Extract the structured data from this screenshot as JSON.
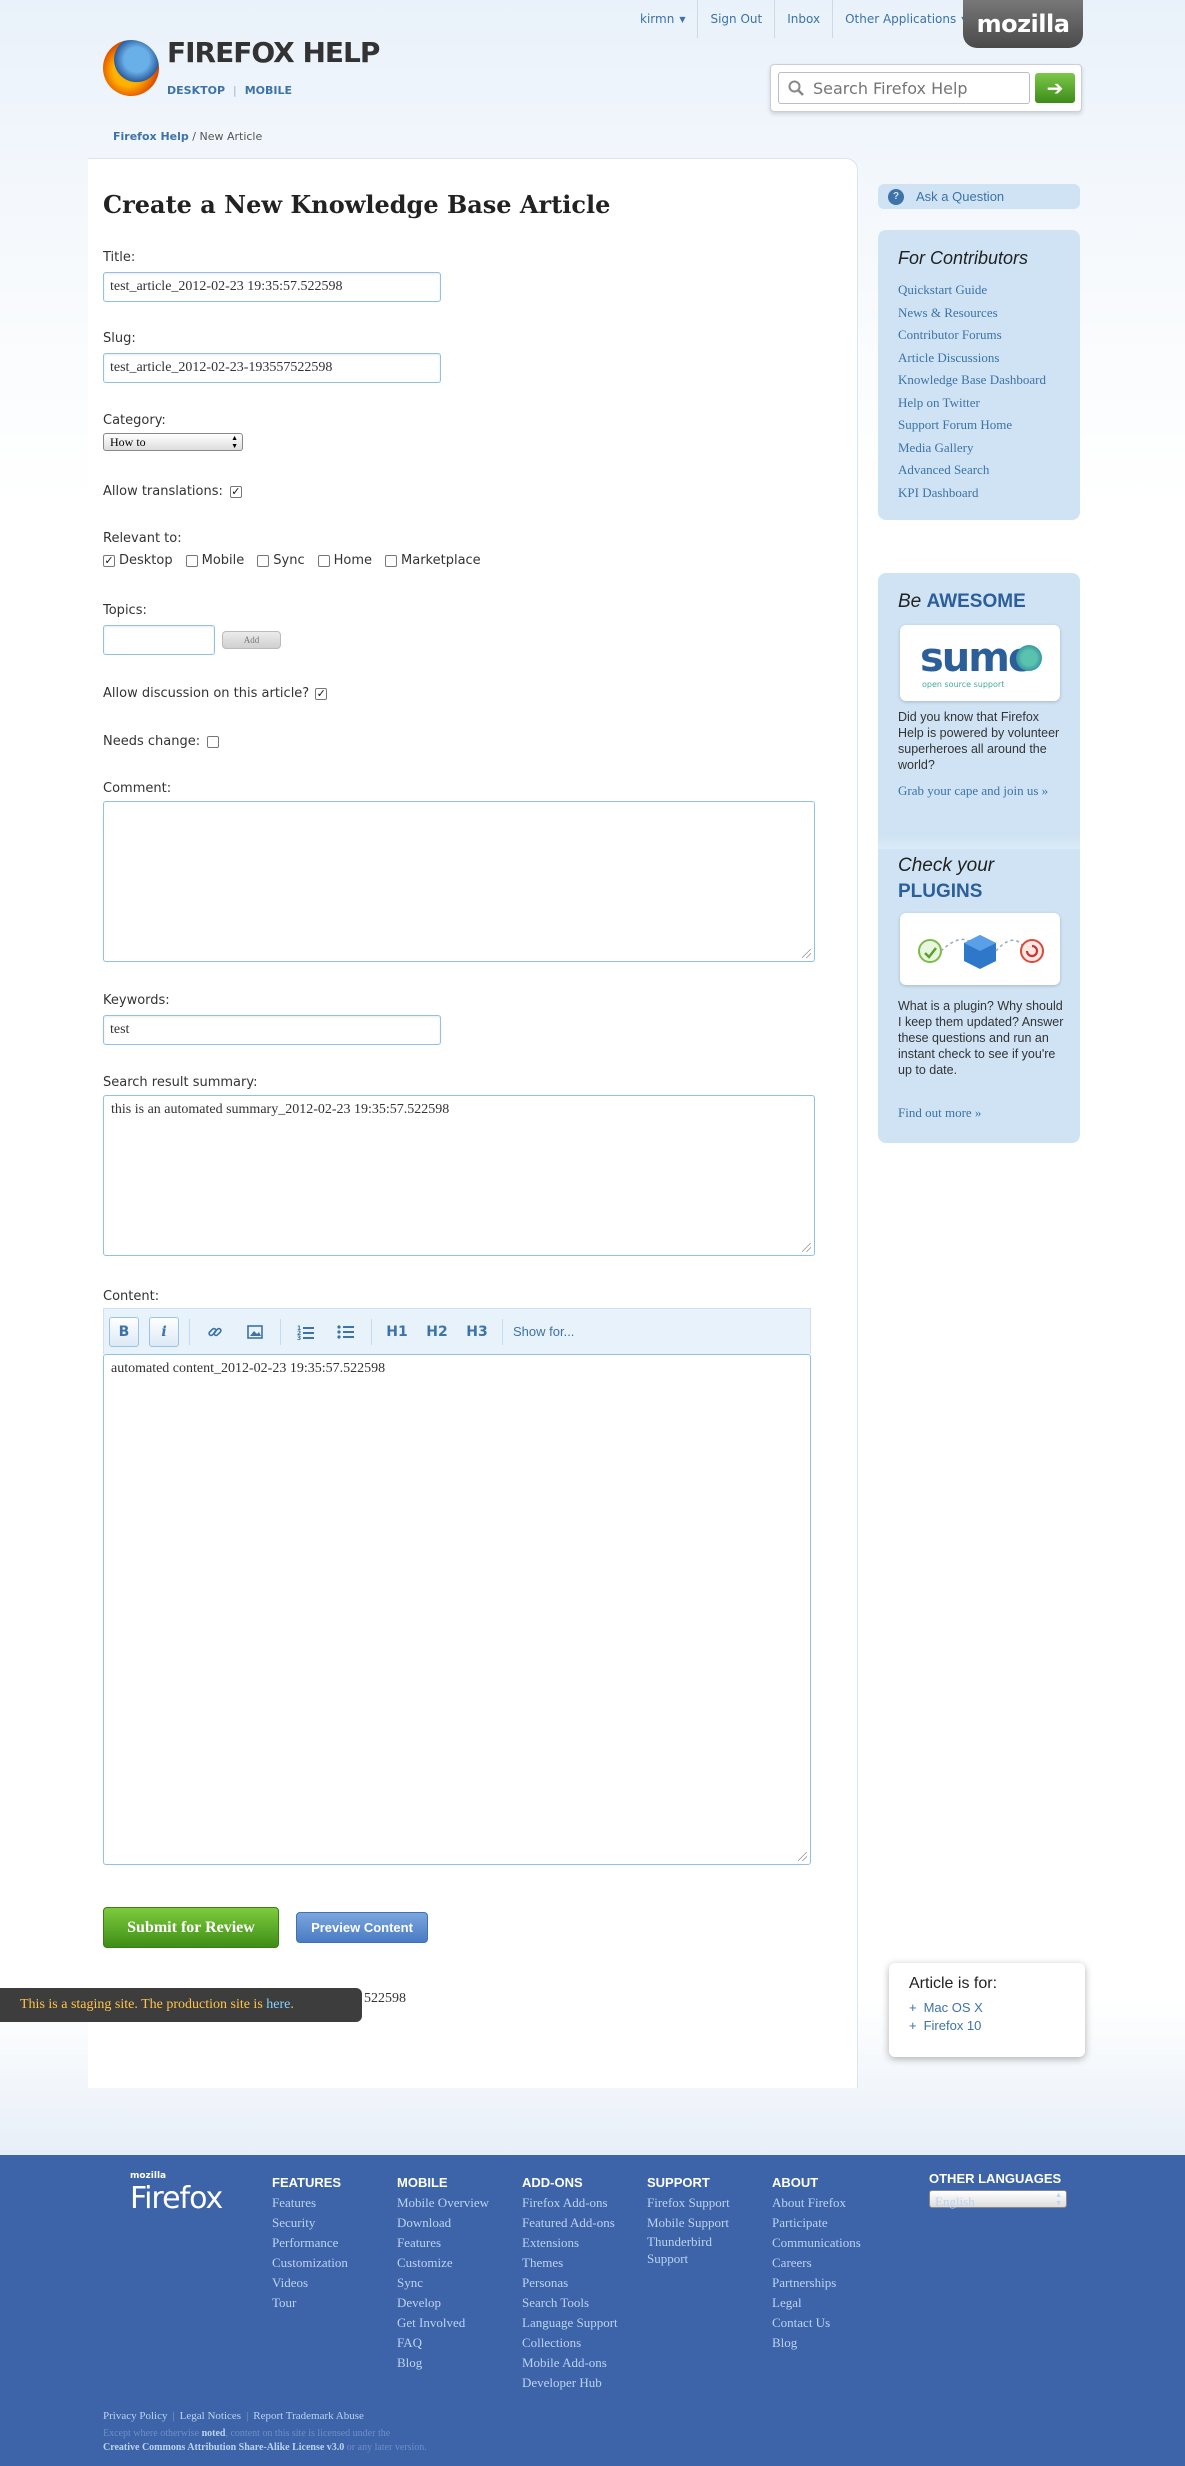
{
  "header": {
    "user_label": "kirmn",
    "sign_out": "Sign Out",
    "inbox": "Inbox",
    "other_apps": "Other Applications",
    "mozilla_tab": "mozilla",
    "brand_title": "FIREFOX HELP",
    "brand_desktop": "DESKTOP",
    "brand_mobile": "MOBILE",
    "search_placeholder": "Search Firefox Help",
    "search_go_icon": "arrow-right-icon"
  },
  "breadcrumb": {
    "home": "Firefox Help",
    "separator": "/",
    "current": "New Article"
  },
  "form": {
    "page_title": "Create a New Knowledge Base Article",
    "title_label": "Title:",
    "title_value": "test_article_2012-02-23 19:35:57.522598",
    "slug_label": "Slug:",
    "slug_value": "test_article_2012-02-23-193557522598",
    "category_label": "Category:",
    "category_value": "How to",
    "allow_translations_label": "Allow translations:",
    "allow_translations_checked": true,
    "relevant_label": "Relevant to:",
    "relevant_options": [
      {
        "label": "Desktop",
        "checked": true
      },
      {
        "label": "Mobile",
        "checked": false
      },
      {
        "label": "Sync",
        "checked": false
      },
      {
        "label": "Home",
        "checked": false
      },
      {
        "label": "Marketplace",
        "checked": false
      }
    ],
    "topics_label": "Topics:",
    "topics_value": "",
    "add_button": "Add",
    "allow_discussion_label": "Allow discussion on this article?",
    "allow_discussion_checked": true,
    "needs_change_label": "Needs change:",
    "needs_change_checked": false,
    "comment_label": "Comment:",
    "comment_value": "",
    "keywords_label": "Keywords:",
    "keywords_value": "test",
    "summary_label": "Search result summary:",
    "summary_value": "this is an automated summary_2012-02-23 19:35:57.522598",
    "content_label": "Content:",
    "content_value": "automated content_2012-02-23 19:35:57.522598",
    "toolbar": {
      "bold": "B",
      "italic": "i",
      "h1": "H1",
      "h2": "H2",
      "h3": "H3",
      "show_for": "Show for..."
    },
    "submit_button": "Submit for Review",
    "preview_button": "Preview Content"
  },
  "staging": {
    "message": "This is a staging site. The production site is ",
    "link": "here",
    "end": "."
  },
  "overlapped_text": "522598",
  "article_for": {
    "title": "Article is for:",
    "items": [
      "Mac OS X",
      "Firefox 10"
    ]
  },
  "sidebar": {
    "ask_question": "Ask a Question",
    "contributors_title": "For Contributors",
    "contributors_links": [
      "Quickstart Guide",
      "News & Resources",
      "Contributor Forums",
      "Article Discussions",
      "Knowledge Base Dashboard",
      "Help on Twitter",
      "Support Forum Home",
      "Media Gallery",
      "Advanced Search",
      "KPI Dashboard"
    ],
    "awesome_be": "Be",
    "awesome_word": "AWESOME",
    "sumo_logo": "sumo",
    "sumo_tagline": "open source support",
    "awesome_text": "Did you know that Firefox Help is powered by volunteer superheroes all around the world?",
    "awesome_link": "Grab your cape and join us »",
    "plugins_check": "Check your",
    "plugins_word": "PLUGINS",
    "plugins_text": "What is a plugin? Why should I keep them updated? Answer these questions and run an instant check to see if you're up to date.",
    "plugins_link": "Find out more »"
  },
  "footer": {
    "brand_small": "mozilla",
    "brand_big": "Firefox",
    "columns": [
      {
        "title": "FEATURES",
        "items": [
          "Features",
          "Security",
          "Performance",
          "Customization",
          "Videos",
          "Tour"
        ]
      },
      {
        "title": "MOBILE",
        "items": [
          "Mobile Overview",
          "Download",
          "Features",
          "Customize",
          "Sync",
          "Develop",
          "Get Involved",
          "FAQ",
          "Blog"
        ]
      },
      {
        "title": "ADD-ONS",
        "items": [
          "Firefox Add-ons",
          "Featured Add-ons",
          "Extensions",
          "Themes",
          "Personas",
          "Search Tools",
          "Language Support",
          "Collections",
          "Mobile Add-ons",
          "Developer Hub"
        ]
      },
      {
        "title": "SUPPORT",
        "items": [
          "Firefox Support",
          "Mobile Support",
          "Thunderbird Support"
        ]
      },
      {
        "title": "ABOUT",
        "items": [
          "About Firefox",
          "Participate",
          "Communications",
          "Careers",
          "Partnerships",
          "Legal",
          "Contact Us",
          "Blog"
        ]
      }
    ],
    "other_languages_title": "OTHER LANGUAGES",
    "language_value": "English",
    "legal_links": [
      "Privacy Policy",
      "Legal Notices",
      "Report Trademark Abuse"
    ],
    "copyright_line1_start": "Except where otherwise",
    "copyright_noted": "noted",
    "copyright_line1_end": ", content on this site is licensed under the",
    "copyright_license": "Creative Commons Attribution Share-Alike License v3.0",
    "copyright_line2_end": "or any later version."
  }
}
